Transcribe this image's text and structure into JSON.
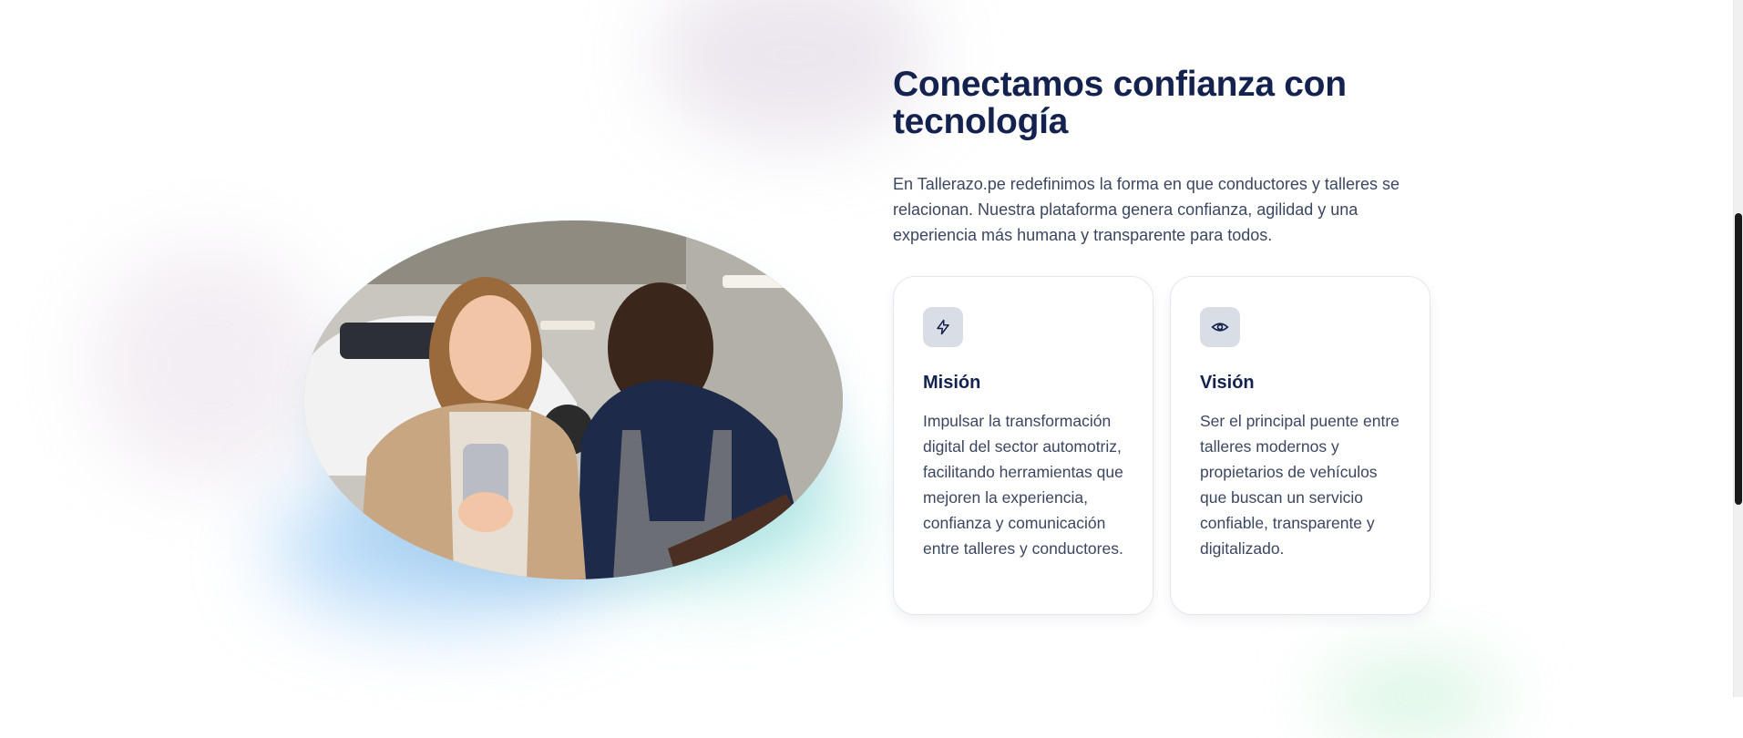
{
  "section": {
    "title": "Conectamos confianza con tecnología",
    "intro": "En Tallerazo.pe redefinimos la forma en que conductores y talleres se relacionan. Nuestra plataforma genera confianza, agilidad y una experiencia más humana y transparente para todos."
  },
  "photo": {
    "icon": "photo-woman-and-mechanic-with-phone"
  },
  "cards": [
    {
      "icon": "lightning-icon",
      "title": "Misión",
      "text": "Impulsar la transformación digital del sector automotriz, facilitando herramientas que mejoren la experiencia, confianza y comunicación entre talleres y conductores."
    },
    {
      "icon": "eye-icon",
      "title": "Visión",
      "text": "Ser el principal puente entre talleres modernos y propietarios de vehículos que buscan un servicio confiable, transparente y digitalizado."
    }
  ],
  "colors": {
    "heading": "#14224f",
    "body": "#3b4660",
    "card_border": "#e3e6ee",
    "icon_bg": "#d9dde6"
  }
}
